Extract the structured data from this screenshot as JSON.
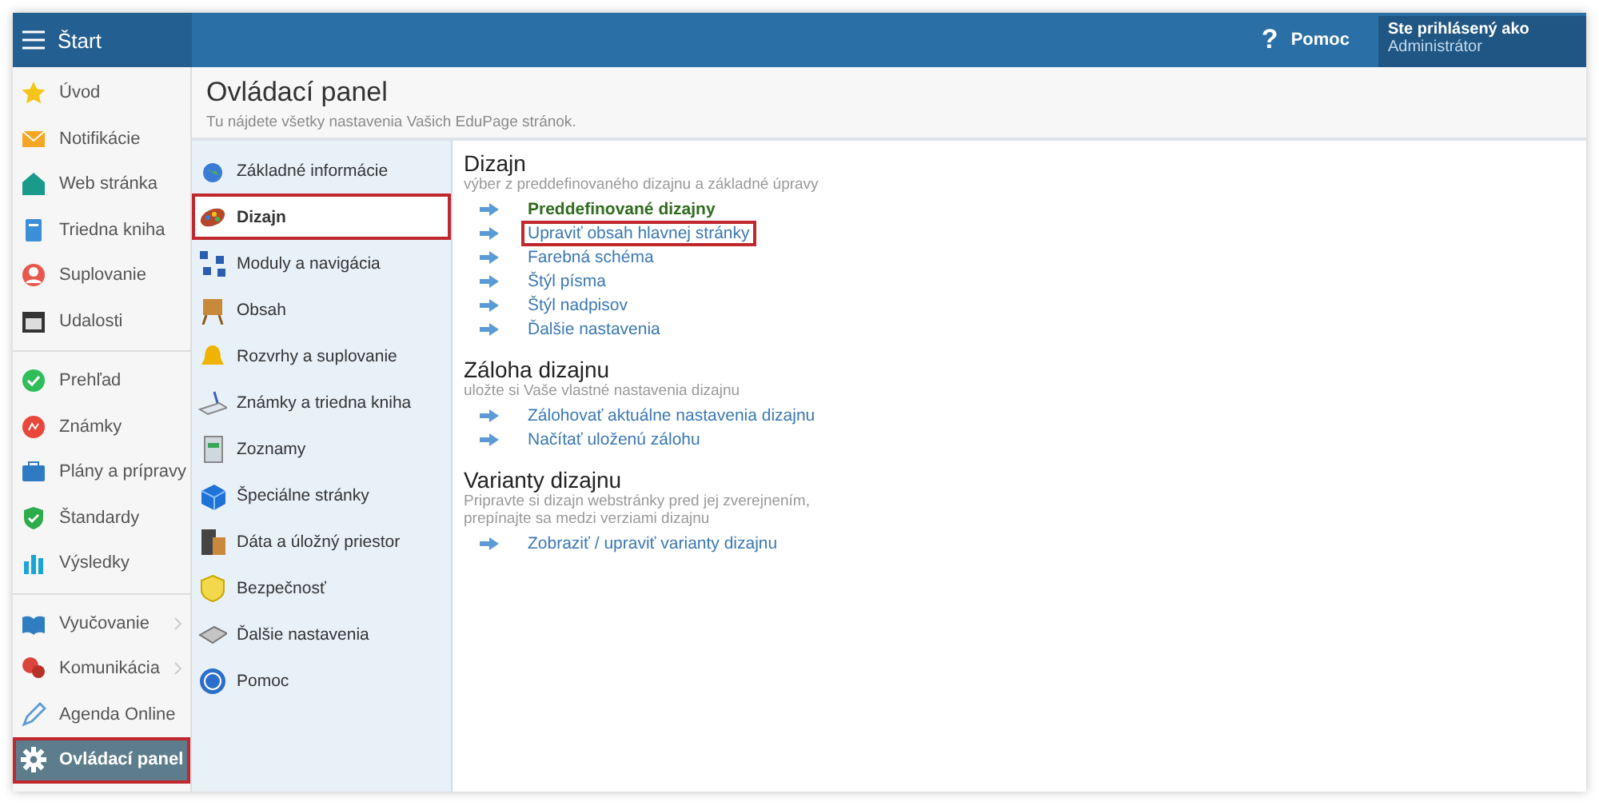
{
  "topbar": {
    "menu_label": "Štart",
    "help_mark": "?",
    "help_label": "Pomoc",
    "user_caption": "Ste prihlásený ako",
    "user_name": "Administrátor"
  },
  "sidebar": {
    "groups": [
      {
        "items": [
          {
            "label": "Úvod",
            "selected": false,
            "submenu": false,
            "highlighted": false
          },
          {
            "label": "Notifikácie",
            "selected": false,
            "submenu": false,
            "highlighted": false
          },
          {
            "label": "Web stránka",
            "selected": false,
            "submenu": false,
            "highlighted": false
          },
          {
            "label": "Triedna kniha",
            "selected": false,
            "submenu": false,
            "highlighted": false
          },
          {
            "label": "Suplovanie",
            "selected": false,
            "submenu": false,
            "highlighted": false
          },
          {
            "label": "Udalosti",
            "selected": false,
            "submenu": false,
            "highlighted": false
          }
        ]
      },
      {
        "items": [
          {
            "label": "Prehľad",
            "selected": false,
            "submenu": false,
            "highlighted": false
          },
          {
            "label": "Známky",
            "selected": false,
            "submenu": false,
            "highlighted": false
          },
          {
            "label": "Plány a prípravy",
            "selected": false,
            "submenu": false,
            "highlighted": false
          },
          {
            "label": "Štandardy",
            "selected": false,
            "submenu": false,
            "highlighted": false
          },
          {
            "label": "Výsledky",
            "selected": false,
            "submenu": false,
            "highlighted": false
          }
        ]
      },
      {
        "items": [
          {
            "label": "Vyučovanie",
            "selected": false,
            "submenu": true,
            "highlighted": false
          },
          {
            "label": "Komunikácia",
            "selected": false,
            "submenu": true,
            "highlighted": false
          },
          {
            "label": "Agenda Online",
            "selected": false,
            "submenu": false,
            "highlighted": false
          },
          {
            "label": "Ovládací panel",
            "selected": true,
            "submenu": false,
            "highlighted": true
          }
        ]
      }
    ]
  },
  "page": {
    "title": "Ovládací panel",
    "subtitle": "Tu nájdete všetky nastavenia Vašich EduPage stránok."
  },
  "menu": [
    {
      "label": "Základné informácie",
      "selected": false,
      "highlighted": false
    },
    {
      "label": "Dizajn",
      "selected": true,
      "highlighted": true
    },
    {
      "label": "Moduly a navigácia",
      "selected": false,
      "highlighted": false
    },
    {
      "label": "Obsah",
      "selected": false,
      "highlighted": false
    },
    {
      "label": "Rozvrhy a suplovanie",
      "selected": false,
      "highlighted": false
    },
    {
      "label": "Známky a triedna kniha",
      "selected": false,
      "highlighted": false
    },
    {
      "label": "Zoznamy",
      "selected": false,
      "highlighted": false
    },
    {
      "label": "Špeciálne stránky",
      "selected": false,
      "highlighted": false
    },
    {
      "label": "Dáta a úložný priestor",
      "selected": false,
      "highlighted": false
    },
    {
      "label": "Bezpečnosť",
      "selected": false,
      "highlighted": false
    },
    {
      "label": "Ďalšie nastavenia",
      "selected": false,
      "highlighted": false
    },
    {
      "label": "Pomoc",
      "selected": false,
      "highlighted": false
    }
  ],
  "sections": [
    {
      "title": "Dizajn",
      "description": "výber z preddefinovaného dizajnu a základné úpravy",
      "links": [
        {
          "label": "Preddefinované dizajny",
          "selected": true,
          "highlighted": false
        },
        {
          "label": "Upraviť obsah hlavnej stránky",
          "selected": false,
          "highlighted": true
        },
        {
          "label": "Farebná schéma",
          "selected": false,
          "highlighted": false
        },
        {
          "label": "Štýl písma",
          "selected": false,
          "highlighted": false
        },
        {
          "label": "Štýl nadpisov",
          "selected": false,
          "highlighted": false
        },
        {
          "label": "Ďalšie nastavenia",
          "selected": false,
          "highlighted": false
        }
      ]
    },
    {
      "title": "Záloha dizajnu",
      "description": "uložte si Vaše vlastné nastavenia dizajnu",
      "links": [
        {
          "label": "Zálohovať aktuálne nastavenia dizajnu",
          "selected": false,
          "highlighted": false
        },
        {
          "label": "Načítať uloženú zálohu",
          "selected": false,
          "highlighted": false
        }
      ]
    },
    {
      "title": "Varianty dizajnu",
      "description": "Pripravte si dizajn webstránky pred jej zverejnením, prepínajte sa medzi verziami dizajnu",
      "links": [
        {
          "label": "Zobraziť / upraviť varianty dizajnu",
          "selected": false,
          "highlighted": false
        }
      ]
    }
  ]
}
